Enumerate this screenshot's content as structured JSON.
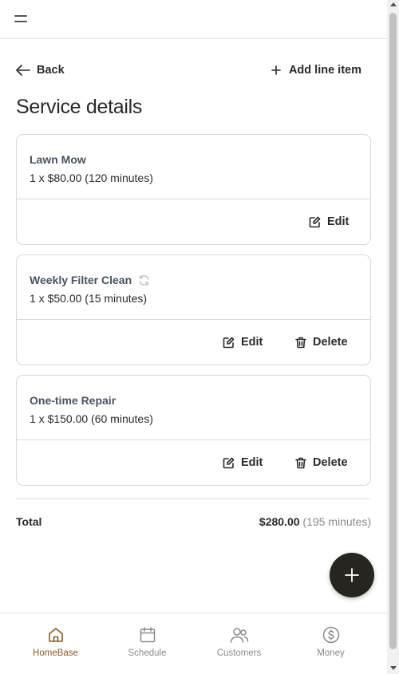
{
  "header": {
    "menu_icon": "hamburger-menu-icon"
  },
  "actions": {
    "back_label": "Back",
    "add_line_item_label": "Add line item"
  },
  "page_title": "Service details",
  "line_items": [
    {
      "name": "Lawn Mow",
      "detail": "1 x $80.00 (120 minutes)",
      "recurring": false,
      "edit_label": "Edit"
    },
    {
      "name": "Weekly Filter Clean",
      "detail": "1 x $50.00 (15 minutes)",
      "recurring": true,
      "edit_label": "Edit",
      "delete_label": "Delete"
    },
    {
      "name": "One-time Repair",
      "detail": "1 x $150.00 (60 minutes)",
      "recurring": false,
      "edit_label": "Edit",
      "delete_label": "Delete"
    }
  ],
  "total": {
    "label": "Total",
    "amount": "$280.00",
    "minutes": "(195 minutes)"
  },
  "bottom_nav": [
    {
      "label": "HomeBase",
      "icon": "home-icon",
      "active": true
    },
    {
      "label": "Schedule",
      "icon": "calendar-icon",
      "active": false
    },
    {
      "label": "Customers",
      "icon": "customers-icon",
      "active": false
    },
    {
      "label": "Money",
      "icon": "dollar-circle-icon",
      "active": false
    }
  ],
  "colors": {
    "text": "#2b2a26",
    "item_name": "#4a5160",
    "accent_active": "#8b5a1e",
    "fab_background": "#26251f",
    "muted": "#8a8a8a",
    "border": "#d8d8d8"
  }
}
